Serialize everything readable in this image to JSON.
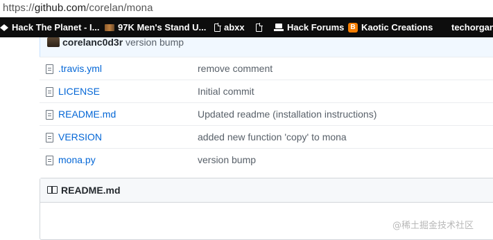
{
  "browser": {
    "url_scheme": "https://",
    "url_host": "github.com",
    "url_path": "/corelan/mona"
  },
  "bookmarks": [
    {
      "label": "Hack The Planet - I...",
      "icon": "hackthebox-icon"
    },
    {
      "label": "97K Men's Stand U...",
      "icon": "thumbnail-icon"
    },
    {
      "label": "abxx",
      "icon": "document-icon"
    },
    {
      "label": "",
      "icon": "document-icon"
    },
    {
      "label": "Hack Forums",
      "icon": "hackforums-icon"
    },
    {
      "label": "Kaotic Creations",
      "icon": "blogger-icon"
    },
    {
      "label": "techorgani",
      "icon": "grid-icon"
    }
  ],
  "commit": {
    "author": "corelanc0d3r",
    "message": "version bump"
  },
  "files": [
    {
      "name": ".travis.yml",
      "message": "remove comment"
    },
    {
      "name": "LICENSE",
      "message": "Initial commit"
    },
    {
      "name": "README.md",
      "message": "Updated readme (installation instructions)"
    },
    {
      "name": "VERSION",
      "message": "added new function 'copy' to mona"
    },
    {
      "name": "mona.py",
      "message": "version bump"
    }
  ],
  "readme": {
    "title": "README.md"
  },
  "watermark": "@稀土掘金技术社区",
  "colors": {
    "link": "#0366d6",
    "muted": "#586069",
    "bookmark_bar": "#0d0d0d",
    "commit_bar": "#f1f8ff"
  }
}
